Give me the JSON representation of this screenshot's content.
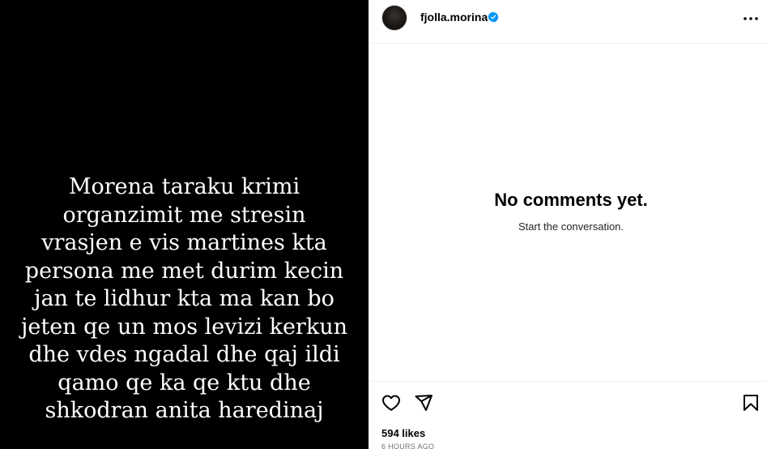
{
  "media": {
    "text_lines": [
      "Morena taraku krimi",
      "organzimit me stresin",
      "vrasjen e vis martines kta",
      "persona me met durim kecin",
      "jan te lidhur kta ma kan bo",
      "jeten qe un mos levizi kerkun",
      "dhe vdes ngadal dhe qaj ildi",
      "qamo qe ka qe ktu dhe",
      "shkodran anita haredinaj"
    ]
  },
  "header": {
    "username": "fjolla.morina",
    "verified_color": "#0095f6",
    "icons": {
      "verified": "verified-badge-icon",
      "more": "more-options-icon"
    }
  },
  "comments": {
    "empty_title": "No comments yet.",
    "empty_subtitle": "Start the conversation."
  },
  "actions": {
    "icons": [
      "heart-icon",
      "share-icon",
      "bookmark-icon"
    ],
    "likes": "594 likes",
    "timestamp": "6 HOURS AGO"
  }
}
